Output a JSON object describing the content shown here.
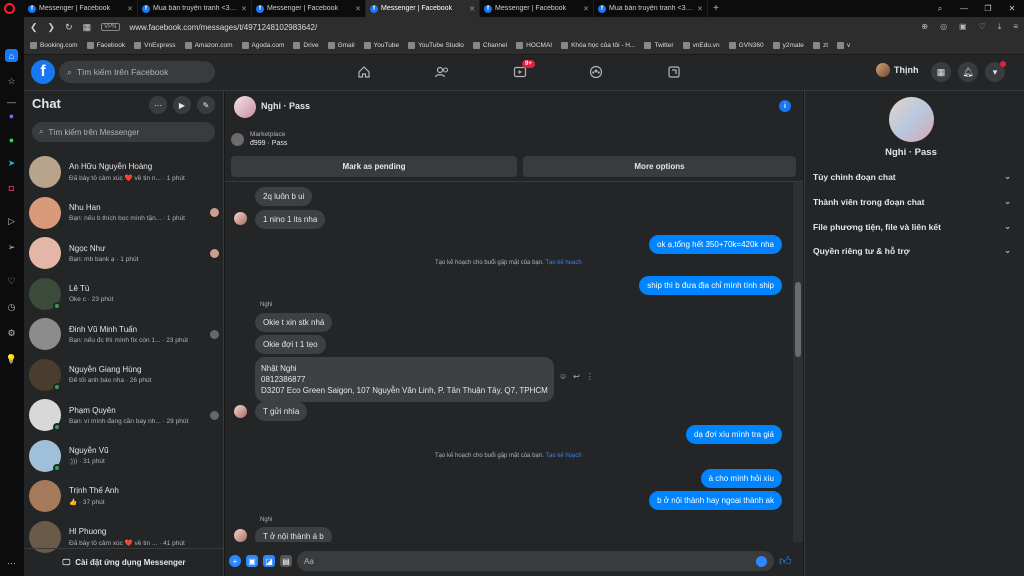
{
  "browser": {
    "tabs": [
      {
        "title": "Messenger | Facebook",
        "active": false
      },
      {
        "title": "Mua bán truyện tranh <3 <3",
        "active": false
      },
      {
        "title": "Messenger | Facebook",
        "active": false
      },
      {
        "title": "Messenger | Facebook",
        "active": true
      },
      {
        "title": "Messenger | Facebook",
        "active": false
      },
      {
        "title": "Mua bán truyện tranh <3 <3",
        "active": false
      }
    ],
    "vpn_label": "VPN",
    "url": "www.facebook.com/messages/t/4971248102983642/",
    "bookmarks": [
      "Booking.com",
      "Facebook",
      "VnExpress",
      "Amazon.com",
      "Agoda.com",
      "Drive",
      "Gmail",
      "YouTube",
      "YouTube Studio",
      "Channel",
      "HOCMAI",
      "Khóa học của tôi - H...",
      "Twitter",
      "vnEdu.vn",
      "GVN360",
      "y2mate",
      "zt",
      "v"
    ]
  },
  "fbnav": {
    "search_placeholder": "Tìm kiếm trên Facebook",
    "watch_badge": "9+",
    "profile_name": "Thịnh"
  },
  "chatlist": {
    "title": "Chat",
    "search_placeholder": "Tìm kiếm trên Messenger",
    "footer": "Cài đặt ứng dụng Messenger",
    "conversations": [
      {
        "name": "An Hữu Nguyễn Hoàng",
        "preview": "Đã bày tỏ cảm xúc ❤️ về tin n... · 1 phút",
        "color": "#b8a48a"
      },
      {
        "name": "Nhu Han",
        "preview": "Bạn: nếu b thích bọc mình tặn... · 1 phút",
        "color": "#d99a7a"
      },
      {
        "name": "Ngọc Như",
        "preview": "Bạn: mb bank ạ · 1 phút",
        "color": "#e3b6a8"
      },
      {
        "name": "Lê Tú",
        "preview": "Oke c · 23 phút",
        "color": "#3c4a3a"
      },
      {
        "name": "Đinh Vũ Minh Tuấn",
        "preview": "Bạn: nếu đc thì mình fix còn 1... · 23 phút",
        "color": "#8c8c8c"
      },
      {
        "name": "Nguyễn Giang Hùng",
        "preview": "Để tối anh báo nha · 26 phút",
        "color": "#4b3d2e"
      },
      {
        "name": "Phạm Quyên",
        "preview": "Bạn: vì mình đang cần bay nh... · 29 phút",
        "color": "#d8d8d8"
      },
      {
        "name": "Nguyễn Vũ",
        "preview": ":))) · 31 phút",
        "color": "#9fc0d8"
      },
      {
        "name": "Trịnh Thế Anh",
        "preview": "👍 · 37 phút",
        "color": "#a47a5a"
      },
      {
        "name": "Hl Phuong",
        "preview": "Đã bày tỏ cảm xúc ❤️ về tin ... · 41 phút",
        "color": "#6a5a4a"
      }
    ]
  },
  "chat": {
    "name": "Nghi · Pass",
    "marketplace_label": "Marketplace",
    "marketplace_item": "đ999 · Pass",
    "mark_pending": "Mark as pending",
    "more_options": "More options",
    "messages": [
      {
        "dir": "in",
        "text": "2q luôn b ui"
      },
      {
        "dir": "in",
        "text": "1 nino 1 its nha"
      },
      {
        "dir": "out",
        "text": "ok ạ,tổng hết 350+70k=420k nha"
      },
      {
        "dir": "out",
        "text": "ship thì b đưa địa chỉ mình tính ship"
      },
      {
        "dir": "in",
        "text": "Okie t xin stk nhá"
      },
      {
        "dir": "in",
        "text": "Okie đợi t 1 tẹo"
      },
      {
        "dir": "in",
        "text": "Nhật Nghi"
      },
      {
        "dir": "in",
        "text": "T gửi nhìa"
      },
      {
        "dir": "out",
        "text": "dạ đợi xíu mình tra giá"
      },
      {
        "dir": "out",
        "text": "à cho mình hỏi xíu"
      },
      {
        "dir": "out",
        "text": "b ở nội thành hay ngoại thành ak"
      },
      {
        "dir": "in",
        "text": "T ở nội thành á b"
      }
    ],
    "address_lines": [
      "Nhật Nghi",
      "0812386877",
      "D3207 Eco Green Saigon, 107 Nguyễn Văn Linh, P. Tân Thuận Tây, Q7, TPHCM"
    ],
    "system_text": "Tạo kế hoạch cho buổi gặp mặt của bạn.",
    "system_link": "Tạo kế hoạch",
    "sender_label": "Nghi",
    "composer_placeholder": "Aa"
  },
  "rightpanel": {
    "name": "Nghi · Pass",
    "sections": [
      "Tùy chỉnh đoạn chat",
      "Thành viên trong đoạn chat",
      "File phương tiện, file và liên kết",
      "Quyền riêng tư & hỗ trợ"
    ]
  }
}
